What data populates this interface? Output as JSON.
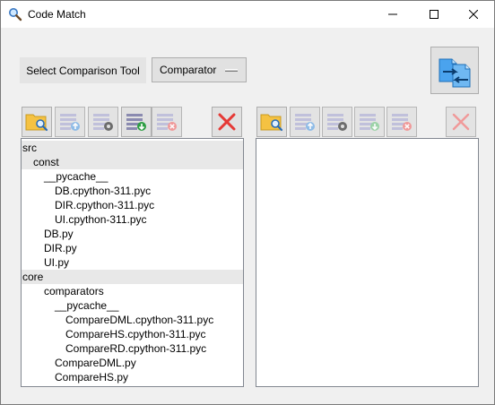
{
  "window": {
    "title": "Code Match",
    "icon": "magnifier-icon",
    "controls": [
      "minimize-icon",
      "maximize-icon",
      "close-icon"
    ]
  },
  "toolbar": {
    "tool_label": "Select Comparison Tool",
    "tool_selected": "Comparator",
    "swap_icon": "swap-panels-icon"
  },
  "left_panel": {
    "buttons": [
      "open-folder-icon",
      "list-upload-icon",
      "list-settings-icon",
      "list-download-icon",
      "list-remove-icon",
      "clear-x-icon"
    ],
    "tree": [
      {
        "label": "src",
        "depth": 0,
        "dir": true
      },
      {
        "label": "const",
        "depth": 1,
        "dir": true
      },
      {
        "label": "__pycache__",
        "depth": 2,
        "dir": false
      },
      {
        "label": "DB.cpython-311.pyc",
        "depth": 3,
        "dir": false
      },
      {
        "label": "DIR.cpython-311.pyc",
        "depth": 3,
        "dir": false
      },
      {
        "label": "UI.cpython-311.pyc",
        "depth": 3,
        "dir": false
      },
      {
        "label": "DB.py",
        "depth": 2,
        "dir": false
      },
      {
        "label": "DIR.py",
        "depth": 2,
        "dir": false
      },
      {
        "label": "UI.py",
        "depth": 2,
        "dir": false
      },
      {
        "label": "core",
        "depth": 0,
        "dir": true
      },
      {
        "label": "comparators",
        "depth": 2,
        "dir": false
      },
      {
        "label": "__pycache__",
        "depth": 3,
        "dir": false
      },
      {
        "label": "CompareDML.cpython-311.pyc",
        "depth": 4,
        "dir": false
      },
      {
        "label": "CompareHS.cpython-311.pyc",
        "depth": 4,
        "dir": false
      },
      {
        "label": "CompareRD.cpython-311.pyc",
        "depth": 4,
        "dir": false
      },
      {
        "label": "CompareDML.py",
        "depth": 3,
        "dir": false
      },
      {
        "label": "CompareHS.py",
        "depth": 3,
        "dir": false
      }
    ]
  },
  "right_panel": {
    "buttons": [
      "open-folder-icon",
      "list-upload-icon",
      "list-settings-icon",
      "list-download-icon",
      "list-remove-icon",
      "clear-x-icon"
    ],
    "tree": []
  },
  "colors": {
    "accent_blue": "#1e88e5",
    "folder_yellow": "#f5c242",
    "red_x": "#e53935",
    "dir_row_bg": "#e8e8e8"
  }
}
